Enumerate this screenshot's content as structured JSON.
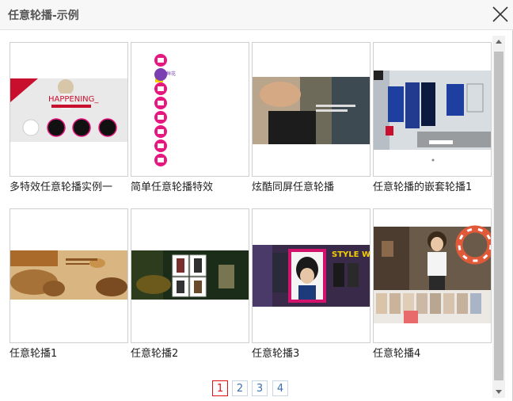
{
  "dialog": {
    "title": "任意轮播-示例"
  },
  "icons": {
    "close": "close-icon",
    "scroll_up": "arrow-up-icon",
    "scroll_down": "arrow-down-icon"
  },
  "items": [
    {
      "caption": "多特效任意轮播实例一",
      "thumb_text": "HAPPENING_"
    },
    {
      "caption": "简单任意轮播特效"
    },
    {
      "caption": "炫酷同屏任意轮播"
    },
    {
      "caption": "任意轮播的嵌套轮播1"
    },
    {
      "caption": "任意轮播1"
    },
    {
      "caption": "任意轮播2"
    },
    {
      "caption": "任意轮播3",
      "thumb_text": "STYLE WISH"
    },
    {
      "caption": "任意轮播4"
    }
  ],
  "pagination": {
    "pages": [
      "1",
      "2",
      "3",
      "4"
    ],
    "current": "1"
  },
  "colors": {
    "active_page": "#dd1111",
    "link": "#3a6fb0",
    "magenta_icons": "#e6177f"
  }
}
